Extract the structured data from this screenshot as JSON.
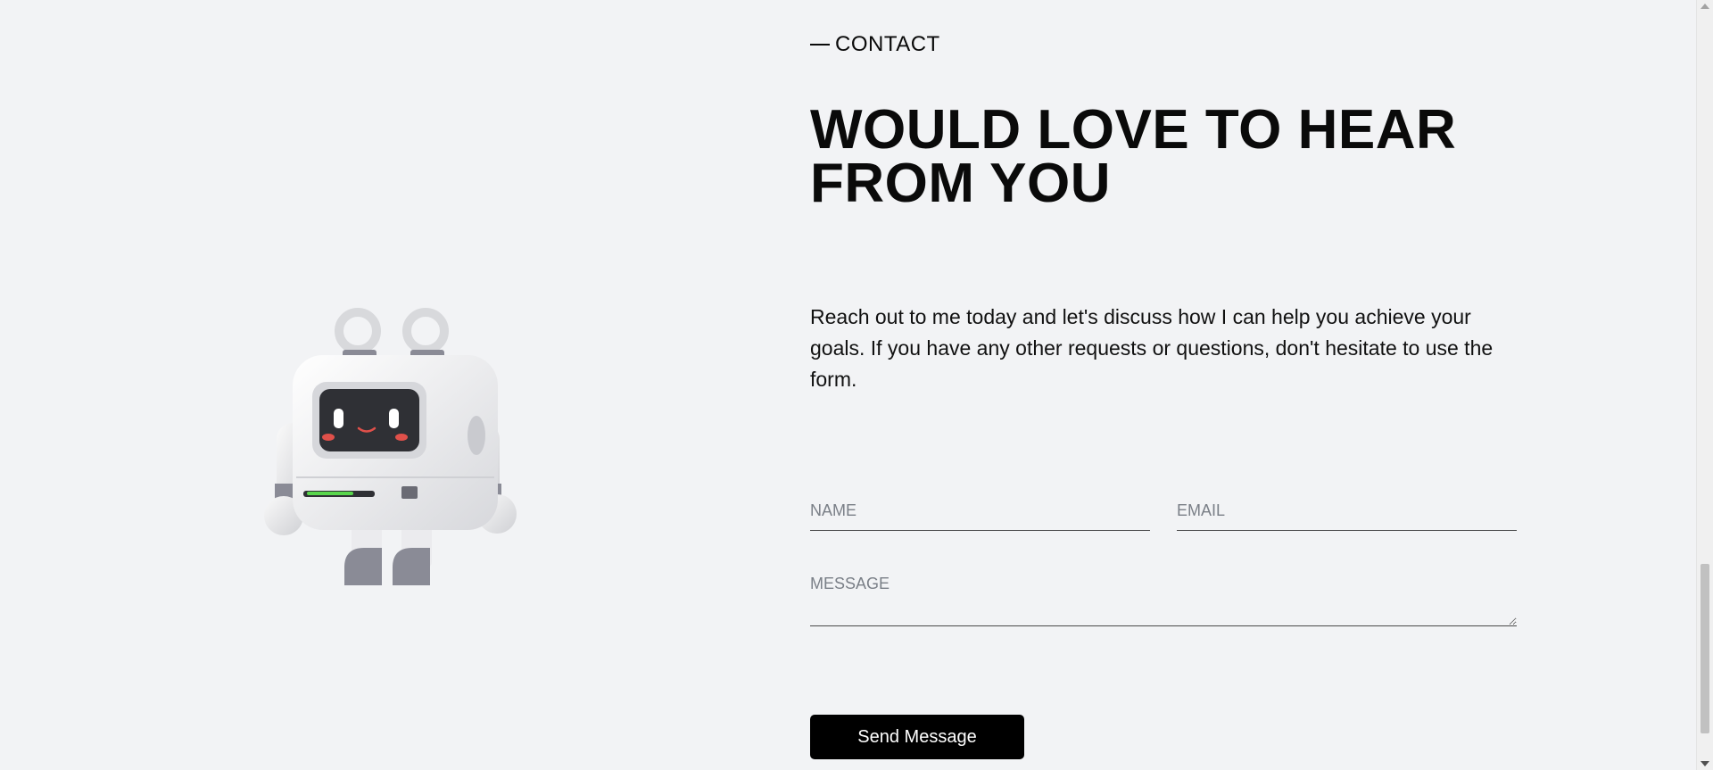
{
  "contact": {
    "eyebrow": "CONTACT",
    "heading": "WOULD LOVE TO HEAR FROM YOU",
    "intro": "Reach out to me today and let's discuss how I can help you achieve your goals. If you have any other requests or questions, don't hesitate to use the form."
  },
  "form": {
    "name_placeholder": "NAME",
    "email_placeholder": "EMAIL",
    "message_placeholder": "MESSAGE",
    "send_label": "Send Message"
  },
  "illustration": {
    "icon": "robot-mascot-icon",
    "accent_green": "#59d64c",
    "blush_color": "#e0504a"
  },
  "colors": {
    "background": "#f2f3f5",
    "button": "#000000",
    "button_text": "#ffffff"
  }
}
